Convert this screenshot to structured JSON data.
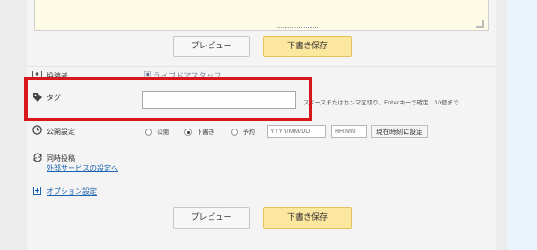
{
  "buttons": {
    "preview": "プレビュー",
    "save_draft": "下書き保存"
  },
  "author": {
    "label": "投稿者",
    "value": "ライブドアスタッフ"
  },
  "tag": {
    "label": "タグ",
    "hint": "スペースまたはカンマ区切り、Enterキーで確定、10個まで",
    "value": ""
  },
  "publish": {
    "label": "公開設定",
    "options": [
      "公開",
      "下書き",
      "予約"
    ],
    "selected": "下書き",
    "date_placeholder": "YYYY/MM/DD",
    "time_placeholder": "HH:MM",
    "now_button": "現在時刻に設定"
  },
  "sync": {
    "label": "同時投稿",
    "link": "外部サービスの設定へ"
  },
  "options_link": "オプション設定",
  "colors": {
    "highlight": "#d8161b",
    "link": "#1b62b0",
    "draft_button": "#fce79e"
  },
  "icons": [
    "author-icon",
    "tag-icon",
    "clock-icon",
    "sync-icon",
    "plus-icon",
    "expand-icon"
  ]
}
